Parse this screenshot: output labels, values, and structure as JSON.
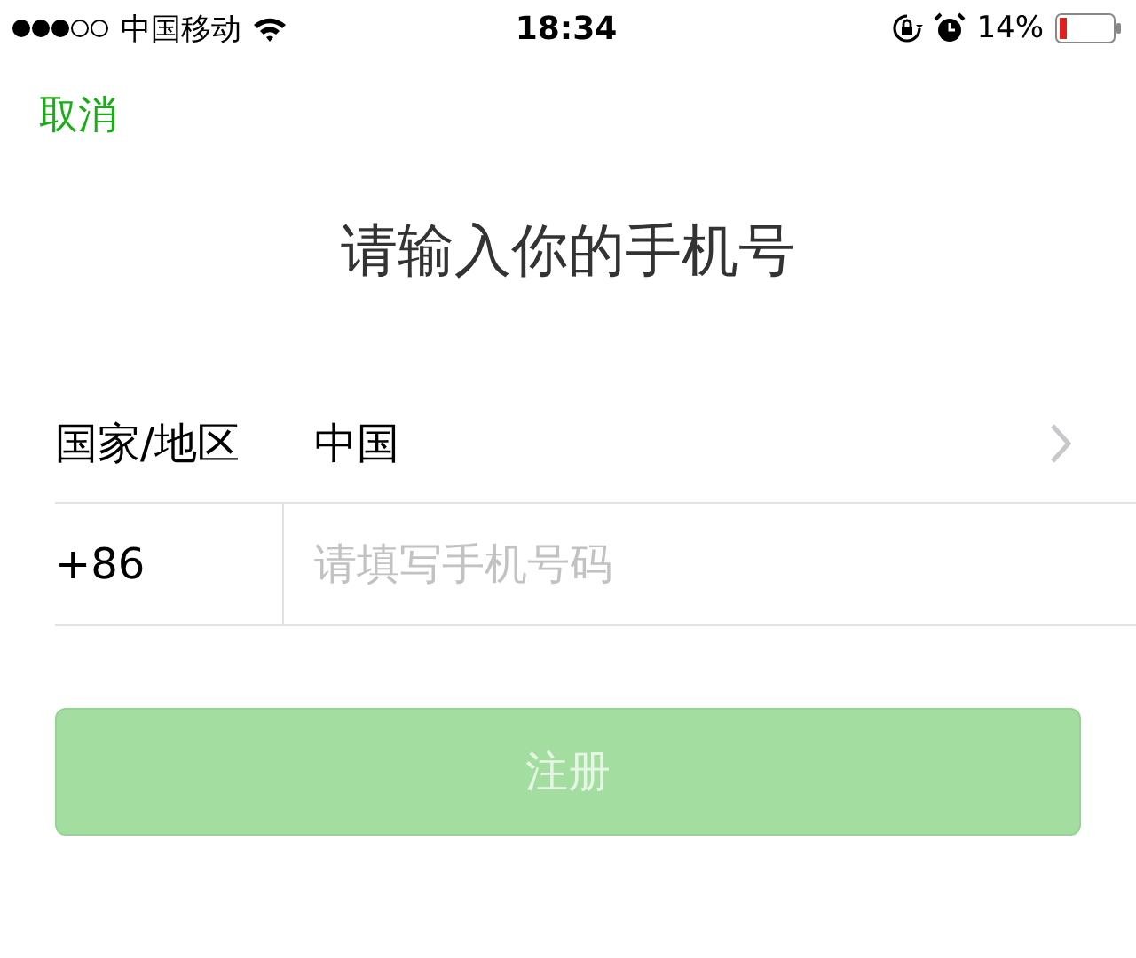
{
  "status_bar": {
    "carrier": "中国移动",
    "time": "18:34",
    "battery": "14%"
  },
  "cancel": "取消",
  "title": "请输入你的手机号",
  "country": {
    "label": "国家/地区",
    "value": "中国"
  },
  "phone": {
    "code": "+86",
    "placeholder": "请填写手机号码"
  },
  "register_button": {
    "label": "注册",
    "disabled": true
  }
}
